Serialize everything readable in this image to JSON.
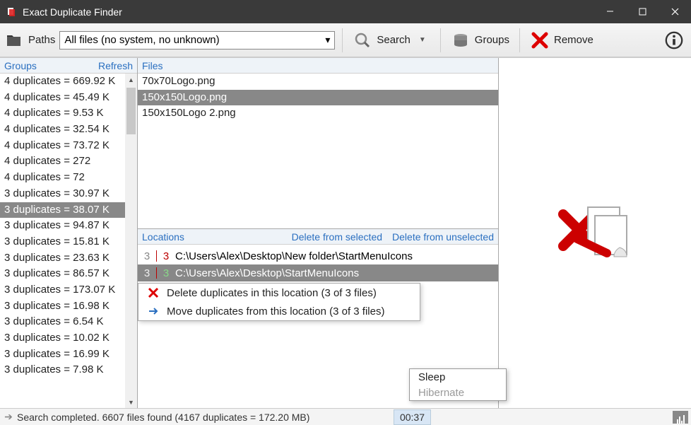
{
  "title": "Exact Duplicate Finder",
  "toolbar": {
    "paths_label": "Paths",
    "path_value": "All files (no system, no unknown)",
    "search_label": "Search",
    "groups_label": "Groups",
    "remove_label": "Remove"
  },
  "groups_panel": {
    "header": "Groups",
    "refresh": "Refresh",
    "selected_index": 8,
    "items": [
      "4 duplicates = 669.92 K",
      "4 duplicates = 45.49 K",
      "4 duplicates = 9.53 K",
      "4 duplicates = 32.54 K",
      "4 duplicates = 73.72 K",
      "4 duplicates = 272",
      "4 duplicates = 72",
      "3 duplicates = 30.97 K",
      "3 duplicates = 38.07 K",
      "3 duplicates = 94.87 K",
      "3 duplicates = 15.81 K",
      "3 duplicates = 23.63 K",
      "3 duplicates = 86.57 K",
      "3 duplicates = 173.07 K",
      "3 duplicates = 16.98 K",
      "3 duplicates = 6.54 K",
      "3 duplicates = 10.02 K",
      "3 duplicates = 16.99 K",
      "3 duplicates = 7.98 K"
    ]
  },
  "files_panel": {
    "header": "Files",
    "selected_index": 1,
    "items": [
      "70x70Logo.png",
      "150x150Logo.png",
      "150x150Logo 2.png"
    ]
  },
  "locations_panel": {
    "header": "Locations",
    "link_delete_selected": "Delete from selected",
    "link_delete_unselected": "Delete from unselected",
    "selected_index": 1,
    "rows": [
      {
        "a": "3",
        "b": "3",
        "path": "C:\\Users\\Alex\\Desktop\\New folder\\StartMenuIcons"
      },
      {
        "a": "3",
        "b": "3",
        "path": "C:\\Users\\Alex\\Desktop\\StartMenuIcons"
      }
    ]
  },
  "context_menu": {
    "delete": "Delete duplicates in this location (3 of 3 files)",
    "move": "Move duplicates from this location (3 of 3 files)"
  },
  "power_menu": {
    "sleep": "Sleep",
    "hibernate": "Hibernate"
  },
  "status": {
    "message": "Search completed. 6607 files found (4167 duplicates = 172.20 MB)",
    "timer": "00:37"
  }
}
